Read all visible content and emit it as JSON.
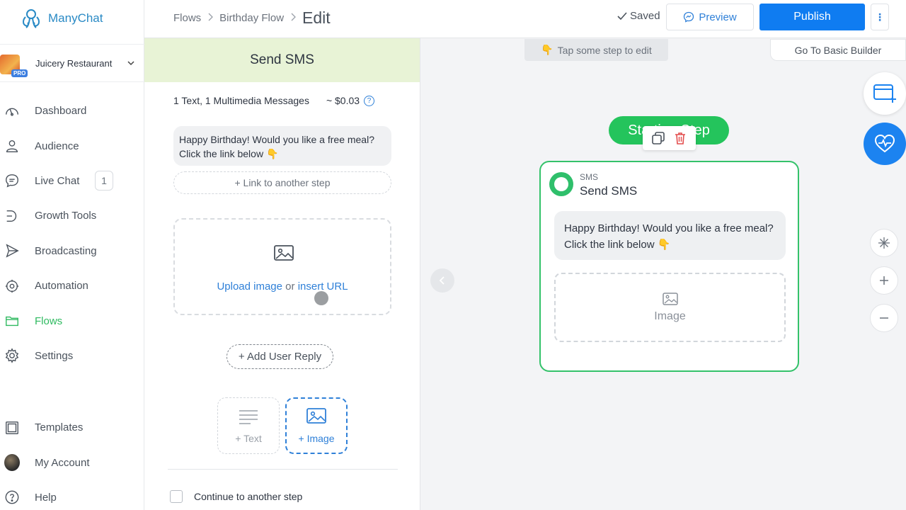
{
  "app": {
    "name": "ManyChat"
  },
  "account": {
    "name": "Juicery Restaurant",
    "badge": "PRO"
  },
  "nav": {
    "items": [
      {
        "label": "Dashboard"
      },
      {
        "label": "Audience"
      },
      {
        "label": "Live Chat",
        "badge": "1"
      },
      {
        "label": "Growth Tools"
      },
      {
        "label": "Broadcasting"
      },
      {
        "label": "Automation"
      },
      {
        "label": "Flows",
        "active": true
      },
      {
        "label": "Settings"
      }
    ],
    "bottom": [
      {
        "label": "Templates"
      },
      {
        "label": "My Account"
      },
      {
        "label": "Help"
      }
    ]
  },
  "header": {
    "crumbs": [
      "Flows",
      "Birthday Flow"
    ],
    "current": "Edit",
    "saved": "Saved",
    "preview": "Preview",
    "publish": "Publish",
    "more": "⋮"
  },
  "panel": {
    "title": "Send SMS",
    "summary": "1 Text, 1 Multimedia Messages",
    "cost": "~ $0.03",
    "help": "?",
    "message": "Happy Birthday! Would you like a free meal? Click the link below 👇",
    "link_step": "+ Link to another step",
    "upload_link": "Upload image",
    "upload_or": " or ",
    "insert_link": "insert URL",
    "add_reply": "+ Add User Reply",
    "tiles": {
      "text": "+ Text",
      "image": "+ Image"
    },
    "continue": "Continue to another step"
  },
  "canvas": {
    "hint": "Tap some step to edit",
    "hint_emoji": "👇",
    "basic_builder": "Go To Basic Builder",
    "start_pill": "Starting Step",
    "node": {
      "kind": "SMS",
      "title": "Send SMS",
      "message": "Happy Birthday! Would you like a free meal? Click the link below 👇",
      "image": "Image"
    }
  },
  "colors": {
    "brand": "#2a8ac5",
    "publish": "#0f7cf1",
    "green": "#24c45c",
    "panel_header": "#e8f3d6"
  }
}
